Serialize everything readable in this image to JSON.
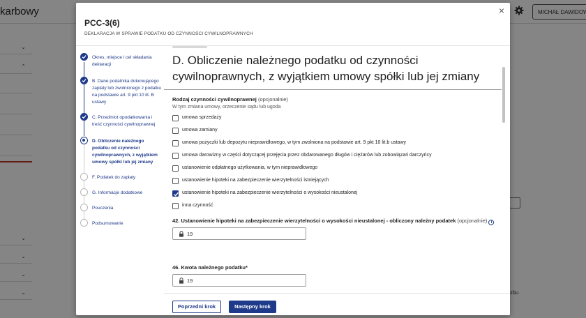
{
  "background": {
    "brand": "karbowy",
    "user_button": "MICHAŁ DAWIDOW"
  },
  "modal": {
    "title": "PCC-3(6)",
    "subtitle": "DEKLARACJA W SPRAWIE PODATKU OD CZYNNOŚCI CYWILNOPRAWNYCH",
    "close_label": "×"
  },
  "steps": [
    {
      "label": "Okres, miejsce i cel składania deklaracji",
      "status": "done"
    },
    {
      "label": "B. Dane podatnika dokonującego zapłaty lub zwolnionego z podatku na podstawie art. 9 pkt 10 lit. B ustawy",
      "status": "done"
    },
    {
      "label": "C. Przedmiot opodatkowania i treść czynności cywilnoprawnej",
      "status": "done"
    },
    {
      "label": "D. Obliczenie należnego podatku od czynności cywilnoprawnych, z wyjątkiem umowy spółki lub jej zmiany",
      "status": "current"
    },
    {
      "label": "F. Podatek do zapłaty",
      "status": "todo"
    },
    {
      "label": "G. Informacje dodatkowe",
      "status": "todo"
    },
    {
      "label": "Pouczenia",
      "status": "todo"
    },
    {
      "label": "Podsumowanie",
      "status": "todo"
    }
  ],
  "section": {
    "title": "D. Obliczenie należnego podatku od czynności cywilnoprawnych, z wyjątkiem umowy spółki lub jej zmiany",
    "question_label": "Rodzaj czynności cywilnoprawnej",
    "question_optional": "(opcjonalnie)",
    "question_hint": "W tym zmiana umowy, orzeczenie sądu lub ugoda",
    "options": [
      {
        "label": "umowa sprzedaży",
        "checked": false
      },
      {
        "label": "umowa zamiany",
        "checked": false
      },
      {
        "label": "umowa pożyczki lub depozytu nieprawidłowego, w tym zwolniona na podstawie art. 9 pkt 10 lit.b ustawy",
        "checked": false
      },
      {
        "label": "umowa darowizny w części dotyczącej przejęcia przez obdarowanego długów i ciężarów lub zobowiązań darczyńcy",
        "checked": false
      },
      {
        "label": "ustanowienie odpłatnego użytkowania, w tym nieprawidłowego",
        "checked": false
      },
      {
        "label": "ustanowienie hipoteki na zabezpieczenie wierzytelności istniejących",
        "checked": false
      },
      {
        "label": "ustanowienie hipoteki na zabezpieczenie wierzytelności o wysokości nieustalonej",
        "checked": true
      },
      {
        "label": "inna czynność",
        "checked": false
      }
    ],
    "field42": {
      "label": "42. Ustanowienie hipoteki na zabezpieczenie wierzytelności o wysokości nieustalonej - obliczony należny podatek",
      "optional": "(opcjonalnie)",
      "value": "19"
    },
    "field46": {
      "label": "46. Kwota należnego podatku*",
      "value": "19"
    }
  },
  "footer": {
    "prev_label": "Poprzedni krok",
    "next_label": "Następny krok"
  },
  "colors": {
    "accent": "#1f3a8a"
  }
}
